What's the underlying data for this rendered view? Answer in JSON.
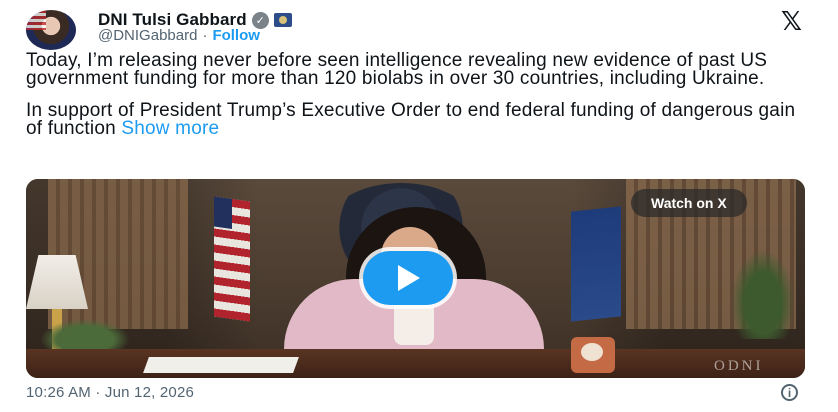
{
  "author": {
    "name": "DNI Tulsi Gabbard",
    "handle": "@DNIGabbard",
    "separator": "·",
    "follow_label": "Follow"
  },
  "icons": {
    "verified": "checkmark-badge",
    "affiliation": "government-seal-badge",
    "platform_logo": "x-logo",
    "play": "play-icon",
    "info": "info-icon"
  },
  "post": {
    "paragraph1": "Today, I’m releasing never before seen intelligence revealing new evidence of past US government funding for more than 120 biolabs in over 30 countries, including Ukraine.",
    "paragraph2": "In support of President Trump’s Executive Order to end federal funding of dangerous gain of function",
    "show_more": "Show more"
  },
  "media": {
    "watch_label": "Watch on X",
    "watermark": "ODNI"
  },
  "footer": {
    "timestamp": "10:26 AM · Jun 12, 2026",
    "info_glyph": "i"
  },
  "colors": {
    "accent": "#1d9bf0",
    "text": "#0f1419",
    "muted": "#536471"
  }
}
